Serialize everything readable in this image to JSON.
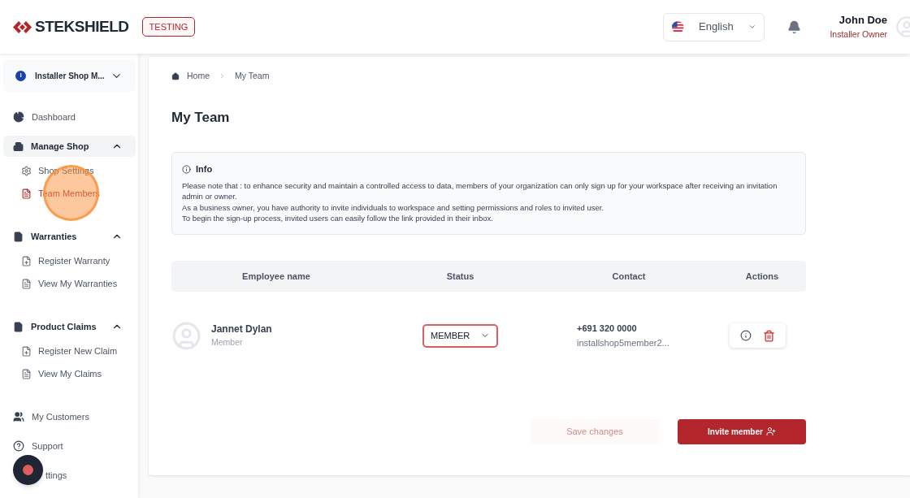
{
  "header": {
    "brand": "STEKSHIELD",
    "env_badge": "TESTING",
    "language": "English",
    "user": {
      "name": "John Doe",
      "role": "Installer Owner"
    }
  },
  "sidebar": {
    "workspace": {
      "initial": "I",
      "name": "Installer Shop M..."
    },
    "items": [
      {
        "kind": "link",
        "label": "Dashboard"
      },
      {
        "kind": "group",
        "label": "Manage Shop",
        "expanded": true,
        "highlighted": true,
        "children": [
          {
            "label": "Shop Settings",
            "selected": false
          },
          {
            "label": "Team Members",
            "selected": true
          }
        ]
      },
      {
        "kind": "group",
        "label": "Warranties",
        "expanded": true,
        "highlighted": false,
        "children": [
          {
            "label": "Register Warranty",
            "selected": false
          },
          {
            "label": "View My Warranties",
            "selected": false
          }
        ]
      },
      {
        "kind": "group",
        "label": "Product Claims",
        "expanded": true,
        "highlighted": false,
        "children": [
          {
            "label": "Register New Claim",
            "selected": false
          },
          {
            "label": "View My Claims",
            "selected": false
          }
        ]
      },
      {
        "kind": "link",
        "label": "My Customers"
      },
      {
        "kind": "link",
        "label": "Support"
      },
      {
        "kind": "link",
        "label": "ttings"
      }
    ]
  },
  "breadcrumb": [
    "Home",
    "My Team"
  ],
  "page_title": "My Team",
  "info": {
    "title": "Info",
    "lines": [
      "Please note that : to enhance security and maintain a controlled access to data, members of your organization can only sign up for your workspace after receiving an invitation admin or owner.",
      "As a business owner, you have authority to invite individuals to workspace and setting permissions and roles to invited user.",
      "To begin the sign-up process, invited users can easily follow the link provided in their inbox."
    ]
  },
  "table": {
    "columns": [
      "Employee name",
      "Status",
      "Contact",
      "Actions"
    ],
    "rows": [
      {
        "name": "Jannet Dylan",
        "role": "Member",
        "status": "MEMBER",
        "phone": "+691 320 0000",
        "email": "installshop5member2..."
      }
    ]
  },
  "buttons": {
    "save": {
      "label": "Save changes",
      "disabled": true
    },
    "invite": {
      "label": "Invite member"
    }
  }
}
